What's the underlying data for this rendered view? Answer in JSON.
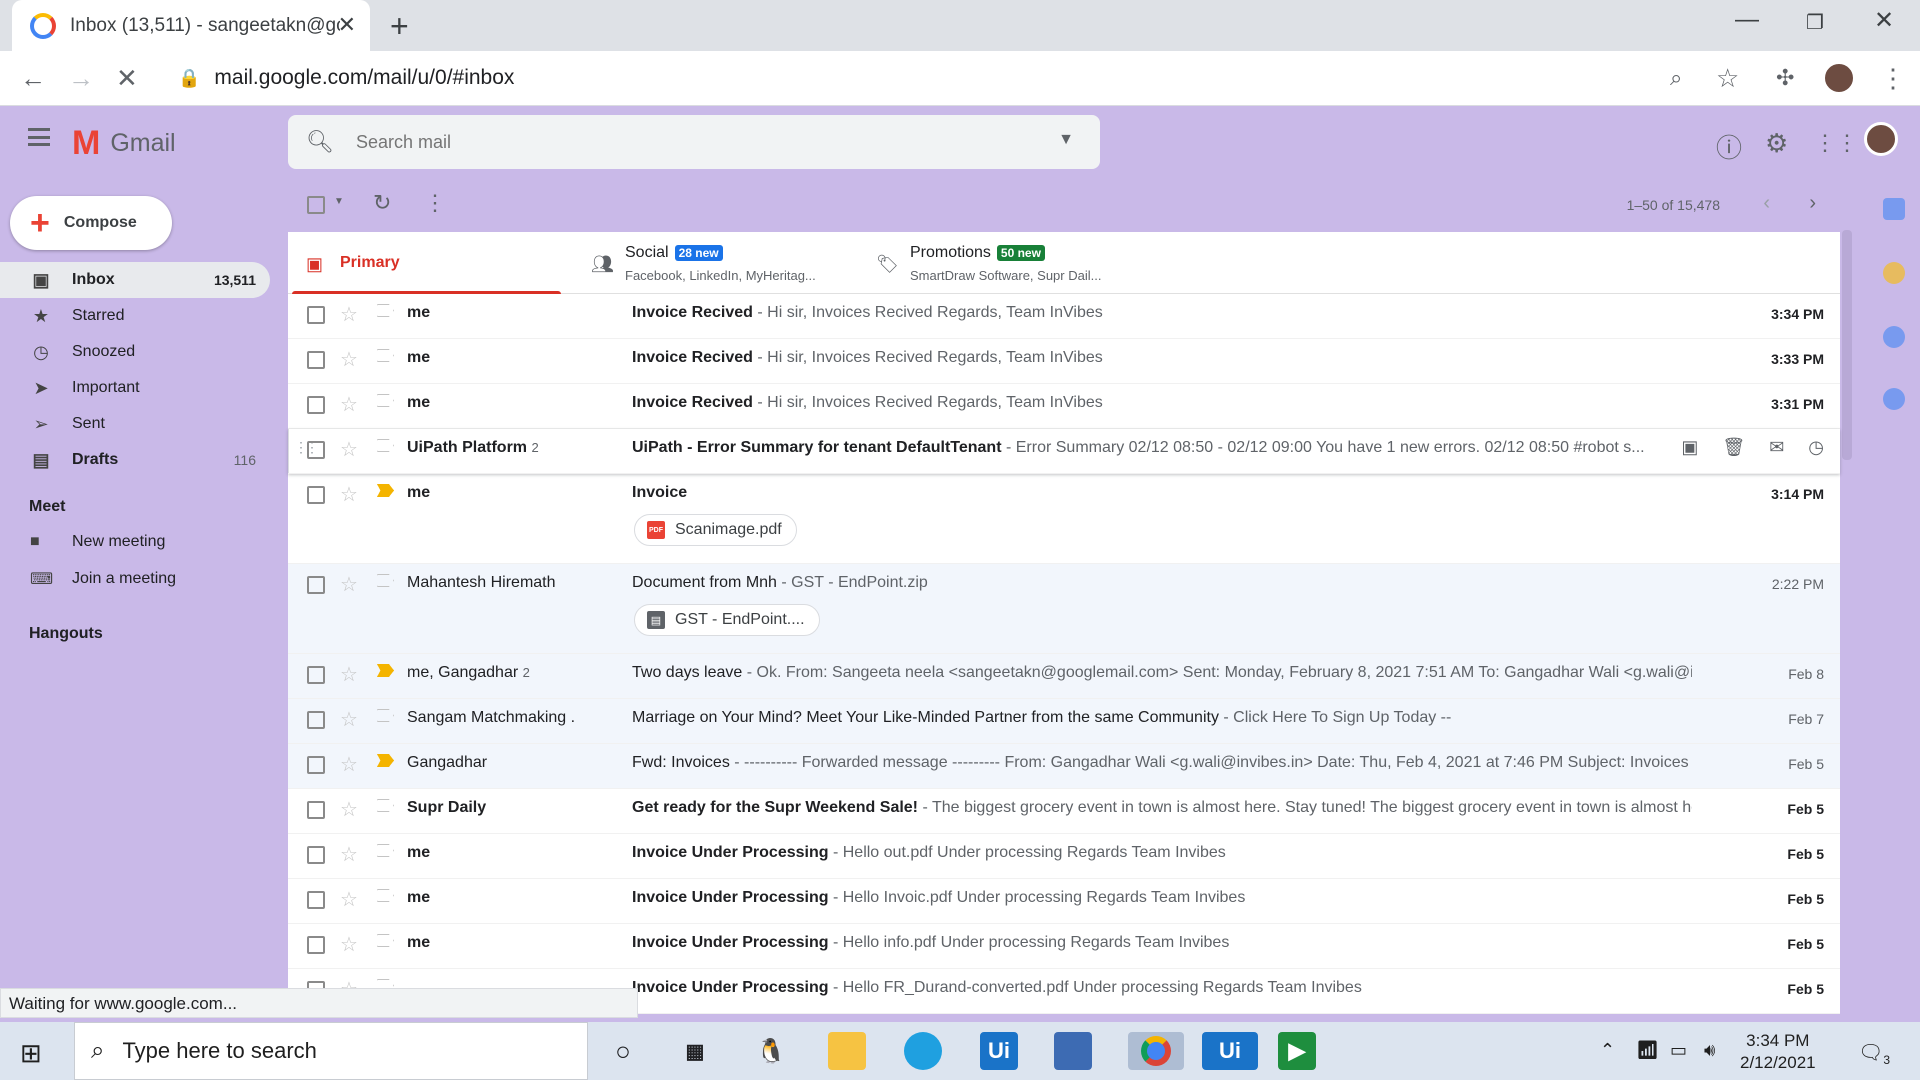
{
  "browser": {
    "tab_title": "Inbox (13,511) - sangeetakn@go",
    "url": "mail.google.com/mail/u/0/#inbox",
    "status_text": "Waiting for www.google.com..."
  },
  "gmail": {
    "logo_text": "Gmail",
    "search_placeholder": "Search mail",
    "compose_label": "Compose",
    "nav": [
      {
        "label": "Inbox",
        "count": "13,511",
        "icon": "inbox-icon"
      },
      {
        "label": "Starred",
        "count": "",
        "icon": "star-icon"
      },
      {
        "label": "Snoozed",
        "count": "",
        "icon": "clock-icon"
      },
      {
        "label": "Important",
        "count": "",
        "icon": "important-icon"
      },
      {
        "label": "Sent",
        "count": "",
        "icon": "send-icon"
      },
      {
        "label": "Drafts",
        "count": "116",
        "icon": "draft-icon"
      }
    ],
    "meet": {
      "title": "Meet",
      "new_meeting": "New meeting",
      "join_meeting": "Join a meeting"
    },
    "hangouts_title": "Hangouts",
    "pagination": "1–50 of 15,478",
    "categories": {
      "primary": {
        "label": "Primary"
      },
      "social": {
        "label": "Social",
        "badge": "28 new",
        "sub": "Facebook, LinkedIn, MyHeritag...",
        "badge_color": "#1a73e8"
      },
      "promotions": {
        "label": "Promotions",
        "badge": "50 new",
        "sub": "SmartDraw Software, Supr Dail...",
        "badge_color": "#188038"
      }
    },
    "emails": [
      {
        "sender": "me",
        "count": "",
        "subject": "Invoice Recived",
        "snippet": " - Hi sir, Invoices Recived Regards, Team InVibes",
        "date": "3:34 PM"
      },
      {
        "sender": "me",
        "count": "",
        "subject": "Invoice Recived",
        "snippet": " - Hi sir, Invoices Recived Regards, Team InVibes",
        "date": "3:33 PM"
      },
      {
        "sender": "me",
        "count": "",
        "subject": "Invoice Recived",
        "snippet": " - Hi sir, Invoices Recived Regards, Team InVibes",
        "date": "3:31 PM"
      },
      {
        "sender": "UiPath Platform",
        "count": "2",
        "subject": "UiPath - Error Summary for tenant DefaultTenant",
        "snippet": " - Error Summary 02/12 08:50 - 02/12 09:00 You have 1 new errors. 02/12 08:50 #robot s...",
        "date": ""
      },
      {
        "sender": "me",
        "count": "",
        "subject": "Invoice",
        "snippet": "",
        "date": "3:14 PM",
        "attachment": "Scanimage.pdf"
      },
      {
        "sender": "Mahantesh Hiremath",
        "count": "",
        "subject": "Document from Mnh",
        "snippet": " - GST - EndPoint.zip",
        "date": "2:22 PM",
        "attachment": "GST - EndPoint...."
      },
      {
        "sender": "me, Gangadhar",
        "count": "2",
        "subject": "Two days leave",
        "snippet": " - Ok. From: Sangeeta neela <sangeetakn@googlemail.com> Sent: Monday, February 8, 2021 7:51 AM To: Gangadhar Wali <g.wali@invi...",
        "date": "Feb 8"
      },
      {
        "sender": "Sangam Matchmaking .",
        "count": "",
        "subject": "Marriage on Your Mind? Meet Your Like-Minded Partner from the same Community",
        "snippet": " - Click Here To Sign Up Today --",
        "date": "Feb 7"
      },
      {
        "sender": "Gangadhar",
        "count": "",
        "subject": "Fwd: Invoices",
        "snippet": " - ---------- Forwarded message --------- From: Gangadhar Wali <g.wali@invibes.in> Date: Thu, Feb 4, 2021 at 7:46 PM Subject: Invoices To: ...",
        "date": "Feb 5"
      },
      {
        "sender": "Supr Daily",
        "count": "",
        "subject": "Get ready for the Supr Weekend Sale!",
        "snippet": " - The biggest grocery event in town is almost here. Stay tuned! The biggest grocery event in town is almost her...",
        "date": "Feb 5"
      },
      {
        "sender": "me",
        "count": "",
        "subject": "Invoice Under Processing",
        "snippet": " - Hello out.pdf Under processing Regards Team Invibes",
        "date": "Feb 5"
      },
      {
        "sender": "me",
        "count": "",
        "subject": "Invoice Under Processing",
        "snippet": " - Hello Invoic.pdf Under processing Regards Team Invibes",
        "date": "Feb 5"
      },
      {
        "sender": "me",
        "count": "",
        "subject": "Invoice Under Processing",
        "snippet": " - Hello info.pdf Under processing Regards Team Invibes",
        "date": "Feb 5"
      },
      {
        "sender": "",
        "count": "",
        "subject": "Invoice Under Processing",
        "snippet": " - Hello FR_Durand-converted.pdf Under processing Regards Team Invibes",
        "date": "Feb 5"
      }
    ]
  },
  "taskbar": {
    "search_placeholder": "Type here to search",
    "time": "3:34 PM",
    "date": "2/12/2021",
    "notification_count": "3"
  }
}
